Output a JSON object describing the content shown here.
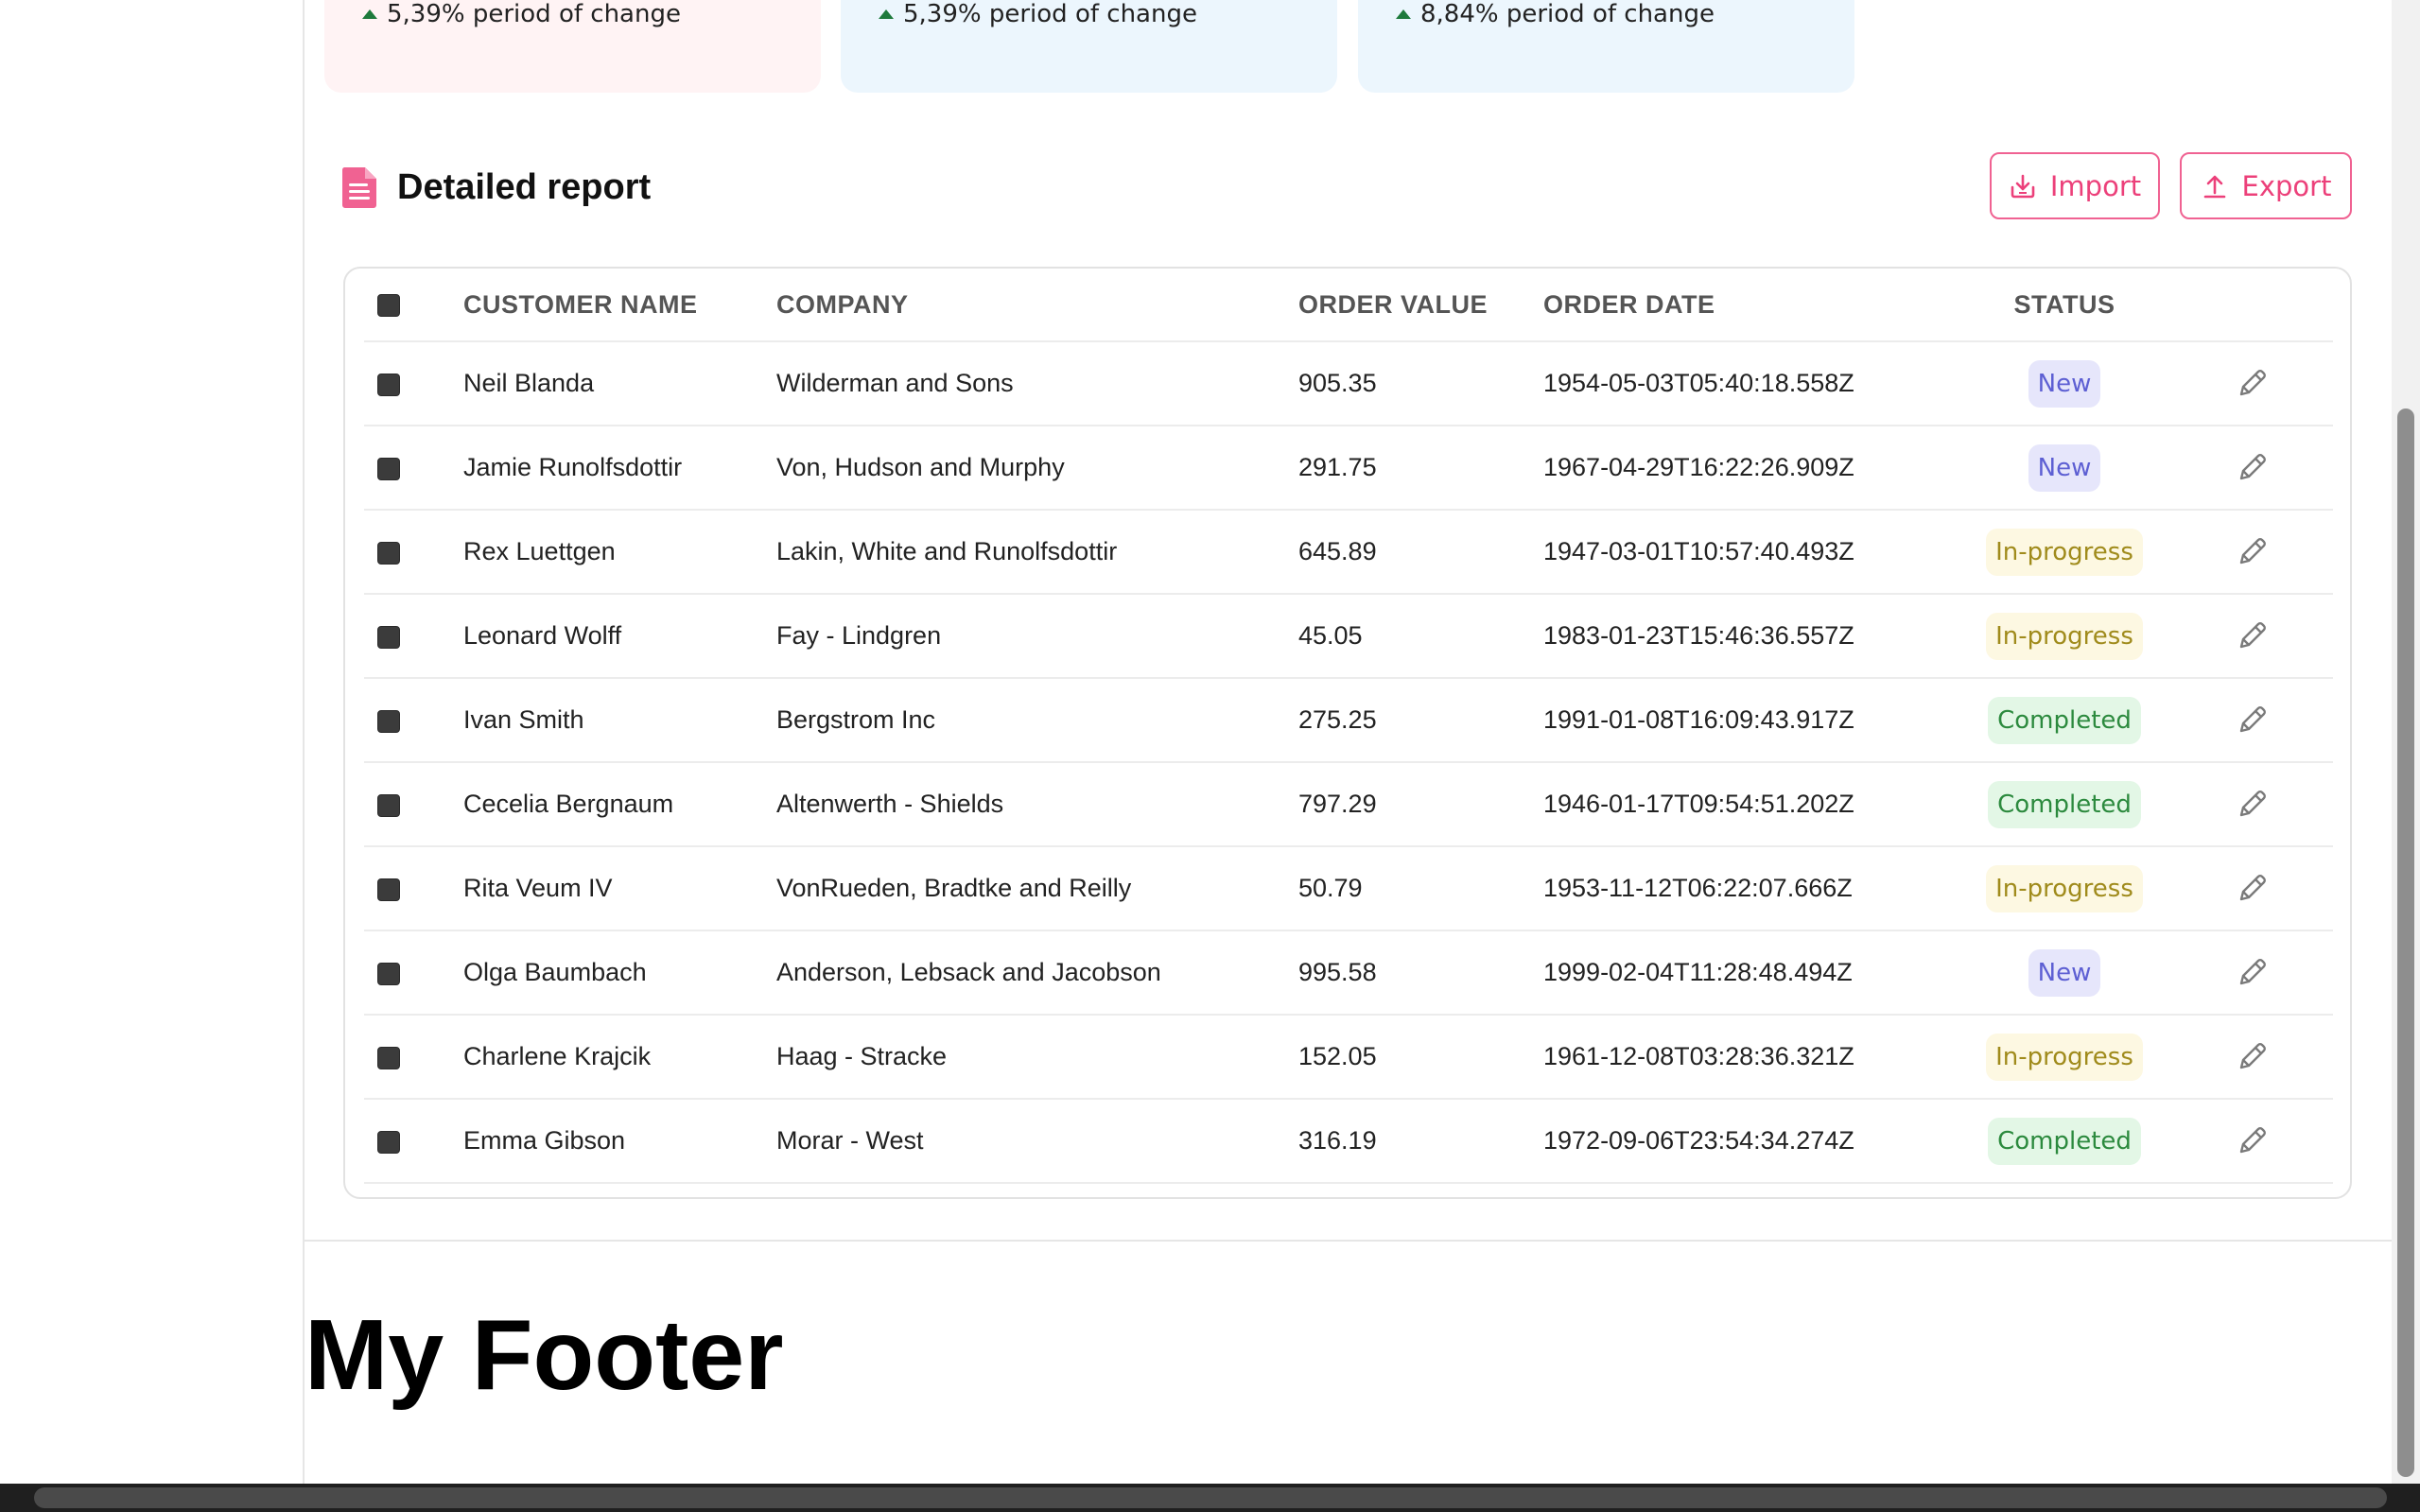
{
  "stat_cards": [
    {
      "change": "5,39% period of change",
      "color": "#fff3f4"
    },
    {
      "change": "5,39% period of change",
      "color": "#ecf6fd"
    },
    {
      "change": "8,84% period of change",
      "color": "#ecf6fd"
    }
  ],
  "report": {
    "title": "Detailed report",
    "icon": "document-icon",
    "import_label": "Import",
    "export_label": "Export",
    "accent": "#ec407a"
  },
  "table": {
    "headers": {
      "name": "CUSTOMER NAME",
      "company": "COMPANY",
      "value": "ORDER VALUE",
      "date": "ORDER DATE",
      "status": "STATUS"
    },
    "rows": [
      {
        "name": "Neil Blanda",
        "company": "Wilderman and Sons",
        "value": "905.35",
        "date": "1954-05-03T05:40:18.558Z",
        "status": "New",
        "kind": "new"
      },
      {
        "name": "Jamie Runolfsdottir",
        "company": "Von, Hudson and Murphy",
        "value": "291.75",
        "date": "1967-04-29T16:22:26.909Z",
        "status": "New",
        "kind": "new"
      },
      {
        "name": "Rex Luettgen",
        "company": "Lakin, White and Runolfsdottir",
        "value": "645.89",
        "date": "1947-03-01T10:57:40.493Z",
        "status": "In-progress",
        "kind": "progress"
      },
      {
        "name": "Leonard Wolff",
        "company": "Fay - Lindgren",
        "value": "45.05",
        "date": "1983-01-23T15:46:36.557Z",
        "status": "In-progress",
        "kind": "progress"
      },
      {
        "name": "Ivan Smith",
        "company": "Bergstrom Inc",
        "value": "275.25",
        "date": "1991-01-08T16:09:43.917Z",
        "status": "Completed",
        "kind": "completed"
      },
      {
        "name": "Cecelia Bergnaum",
        "company": "Altenwerth - Shields",
        "value": "797.29",
        "date": "1946-01-17T09:54:51.202Z",
        "status": "Completed",
        "kind": "completed"
      },
      {
        "name": "Rita Veum IV",
        "company": "VonRueden, Bradtke and Reilly",
        "value": "50.79",
        "date": "1953-11-12T06:22:07.666Z",
        "status": "In-progress",
        "kind": "progress"
      },
      {
        "name": "Olga Baumbach",
        "company": "Anderson, Lebsack and Jacobson",
        "value": "995.58",
        "date": "1999-02-04T11:28:48.494Z",
        "status": "New",
        "kind": "new"
      },
      {
        "name": "Charlene Krajcik",
        "company": "Haag - Stracke",
        "value": "152.05",
        "date": "1961-12-08T03:28:36.321Z",
        "status": "In-progress",
        "kind": "progress"
      },
      {
        "name": "Emma Gibson",
        "company": "Morar - West",
        "value": "316.19",
        "date": "1972-09-06T23:54:34.274Z",
        "status": "Completed",
        "kind": "completed"
      }
    ]
  },
  "footer": {
    "title": "My Footer"
  }
}
